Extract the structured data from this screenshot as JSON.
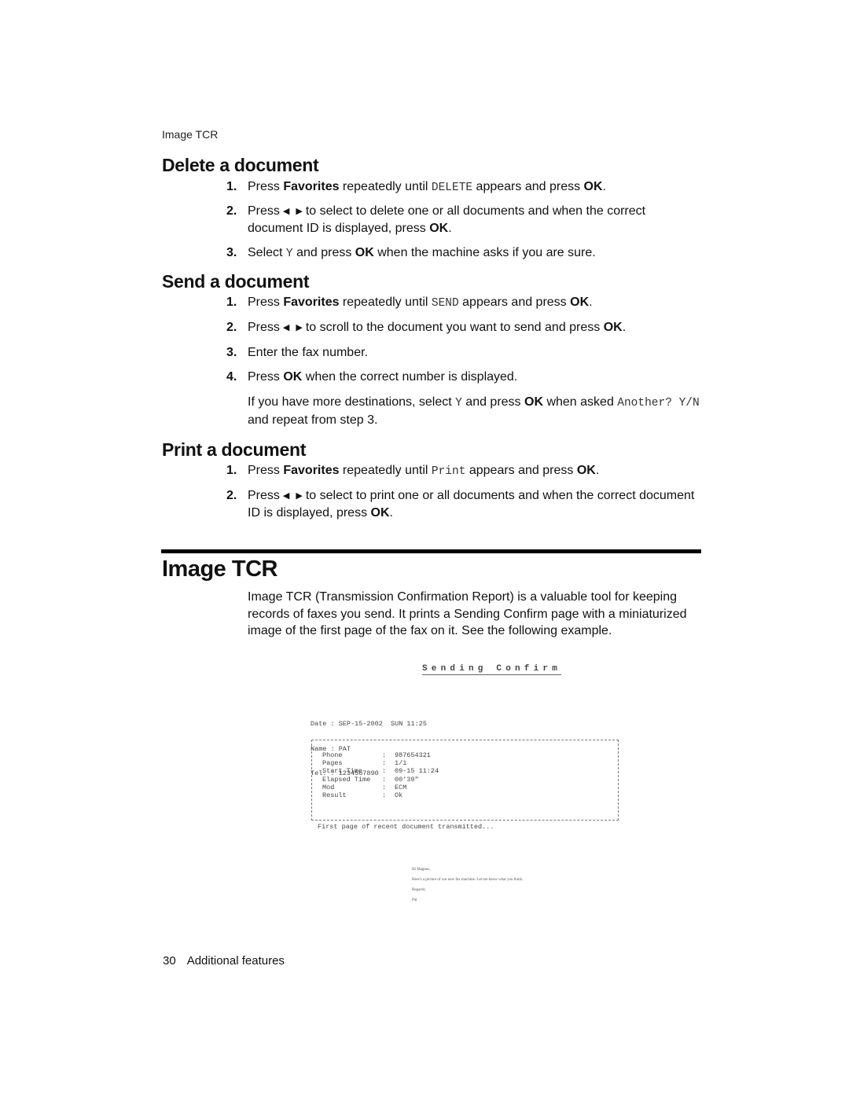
{
  "running_head": "Image TCR",
  "sections": {
    "delete": {
      "title": "Delete a document",
      "steps": [
        {
          "num": "1.",
          "pre": "Press ",
          "bold1": "Favorites",
          "mid": " repeatedly until ",
          "code": "DELETE",
          "post": " appears and press ",
          "bold2": "OK",
          "end": "."
        },
        {
          "num": "2.",
          "pre": "Press",
          "post": "to select to delete one or all documents and when the correct document ID is displayed, press ",
          "bold2": "OK",
          "end": "."
        },
        {
          "num": "3.",
          "pre": "Select ",
          "code": "Y",
          "mid": " and press ",
          "bold2": "OK",
          "post": " when the machine asks if you are sure."
        }
      ]
    },
    "send": {
      "title": "Send a document",
      "steps": [
        {
          "num": "1.",
          "pre": "Press ",
          "bold1": "Favorites",
          "mid": " repeatedly until ",
          "code": "SEND",
          "post": " appears and press ",
          "bold2": "OK",
          "end": "."
        },
        {
          "num": "2.",
          "pre": "Press",
          "post": "to scroll to the document you want to send and press ",
          "bold2": "OK",
          "end": "."
        },
        {
          "num": "3.",
          "text": "Enter the fax number."
        },
        {
          "num": "4.",
          "pre": "Press ",
          "bold2": "OK",
          "post": " when the correct number is displayed."
        }
      ],
      "note": {
        "pre": "If you have more destinations, select ",
        "code1": "Y",
        "mid": " and press ",
        "bold": "OK",
        "mid2": " when asked ",
        "code2": "Another? Y/N",
        "post": " and repeat from step 3."
      }
    },
    "print": {
      "title": "Print a document",
      "steps": [
        {
          "num": "1.",
          "pre": "Press ",
          "bold1": "Favorites",
          "mid": " repeatedly until ",
          "code": "Print",
          "post": " appears and press ",
          "bold2": "OK",
          "end": "."
        },
        {
          "num": "2.",
          "pre": "Press",
          "post": "to select to print one or all documents and when the correct document ID is displayed, press ",
          "bold2": "OK",
          "end": "."
        }
      ]
    }
  },
  "arrows": {
    "left": "◀",
    "right": "▶"
  },
  "image_tcr": {
    "title": "Image TCR",
    "body": "Image TCR (Transmission Confirmation Report) is a valuable tool for keeping records of faxes you send. It prints a Sending Confirm page with a miniaturized image of the first page of the fax on it. See the following example."
  },
  "fax_example": {
    "title": "Sending Confirm",
    "header_lines": [
      "Date : SEP-15-2002  SUN 11:25",
      "Name : PAT",
      "Tel. : 1234567890"
    ],
    "rows": [
      {
        "key": "Phone",
        "value": "987654321"
      },
      {
        "key": "Pages",
        "value": "1/1"
      },
      {
        "key": "Start Time",
        "value": "09-15 11:24"
      },
      {
        "key": "Elapsed Time",
        "value": "00'39\""
      },
      {
        "key": "Mod",
        "value": "ECM"
      },
      {
        "key": "Result",
        "value": "Ok"
      }
    ],
    "separator": ":",
    "footer": "First page of recent document transmitted...",
    "letter_lines": [
      "Hi Magnus,",
      "Here's a picture of our new fax machine. Let me know what you think.",
      "Regards,",
      "Pat"
    ]
  },
  "footer": {
    "page": "30",
    "section": "Additional features"
  }
}
